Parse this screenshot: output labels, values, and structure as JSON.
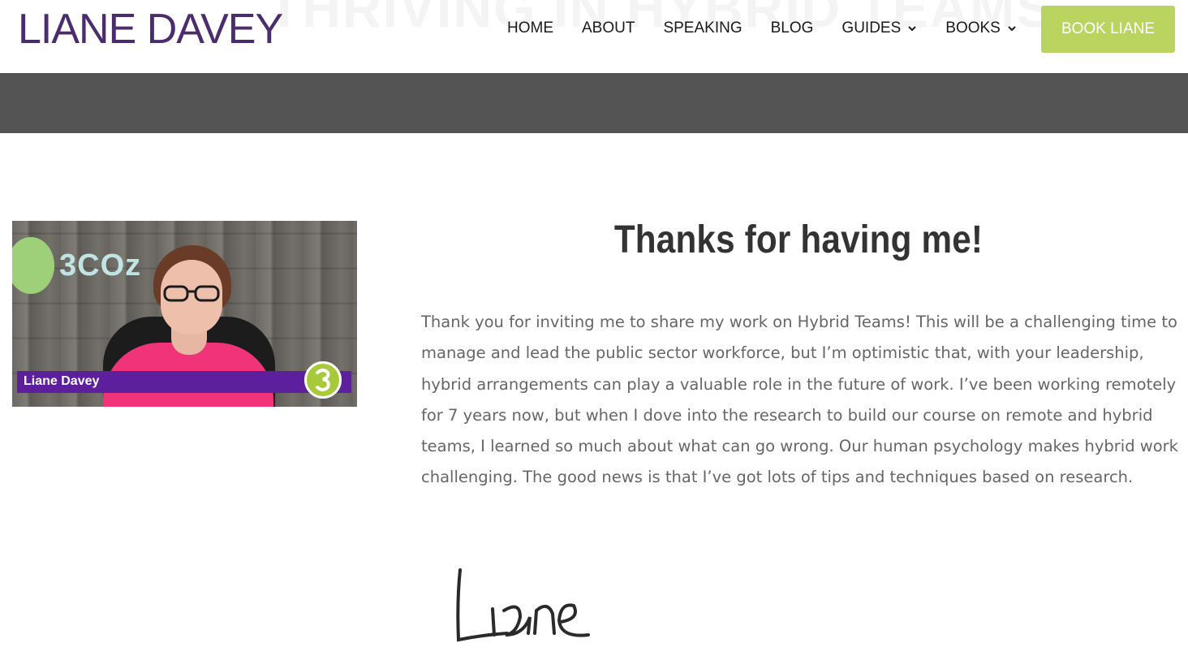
{
  "header": {
    "logo_text": "LIANE DAVEY",
    "ghost_title": "THRIVING IN HYBRID TEAMS",
    "nav": [
      {
        "label": "HOME"
      },
      {
        "label": "ABOUT"
      },
      {
        "label": "SPEAKING"
      },
      {
        "label": "BLOG"
      },
      {
        "label": "GUIDES",
        "dropdown": true
      },
      {
        "label": "BOOKS",
        "dropdown": true
      }
    ],
    "cta_label": "BOOK LIANE"
  },
  "colors": {
    "brand_purple": "#4b2d6f",
    "cta_green": "#b9d45f",
    "band_gray": "#545454",
    "lower_third_purple": "#5e1f9c"
  },
  "video": {
    "brand_text": "3COz",
    "lower_third_name": "Liane Davey"
  },
  "content": {
    "heading": "Thanks for having me!",
    "body": "Thank you for inviting me to share my work on Hybrid Teams! This will be a challenging time to manage and lead the public sector workforce, but I’m optimistic that, with your leadership, hybrid arrangements can play a valuable role in the future of work. I’ve been working remotely for 7 years now, but when I dove into the research to build our course on remote and hybrid teams, I learned so much about what can go wrong. Our human psychology makes hybrid work challenging. The good news is that I’ve got lots of tips and techniques based on research.",
    "signature": "Liane"
  }
}
